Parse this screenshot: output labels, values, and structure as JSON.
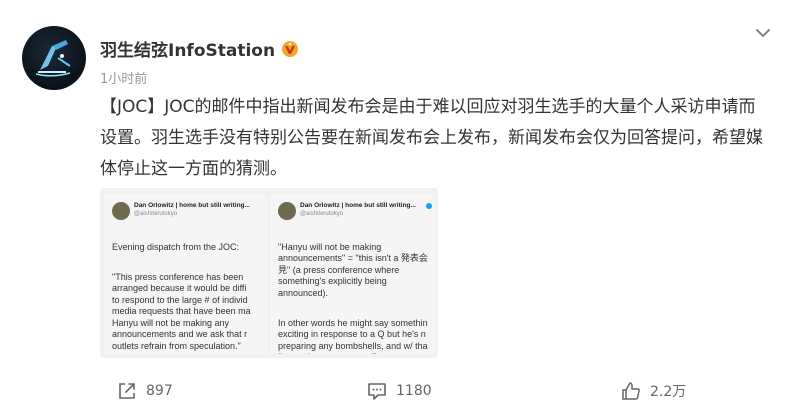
{
  "post": {
    "author": "羽生结弦InfoStation",
    "time": "1小时前",
    "text": "【JOC】JOC的邮件中指出新闻发布会是由于难以回应对羽生选手的大量个人采访申请而设置。羽生选手没有特别公告要在新闻发布会上发布，新闻发布会仅为回答提问，希望媒体停止这一方面的猜测。"
  },
  "embed": {
    "tweet1": {
      "name": "Dan Orlowitz | home but still writing...",
      "handle": "@aishiterutokyo",
      "paragraphs": [
        "Evening dispatch from the JOC:",
        "\"This press conference has been\narranged because it would be diffi\nto respond to the large # of individ\nmedia requests that have been ma\nHanyu will not be making any\nannouncements and we ask that r\noutlets refrain from speculation.\""
      ]
    },
    "tweet2": {
      "name": "Dan Orlowitz | home but still writing...",
      "handle": "@aishiterutokyo",
      "paragraphs": [
        "\"Hanyu will not be making\nannouncements\" = \"this isn't a 発表会\n見\" (a press conference where\nsomething's explicitly being\nannounced).",
        "In other words he might say somethin\nexciting in response to a Q but he's n\npreparing any bombshells, and w/ tha\nI'm turning responses off."
      ]
    }
  },
  "actions": {
    "repost_count": "897",
    "comment_count": "1180",
    "like_count": "2.2万"
  },
  "icons": {
    "badge": "gold-v-badge-icon",
    "menu": "chevron-down-icon",
    "repost": "share-icon",
    "comment": "comment-icon",
    "like": "thumbs-up-icon"
  },
  "colors": {
    "badge_gold": "#f5a623",
    "verified_blue": "#1d9bf0"
  }
}
